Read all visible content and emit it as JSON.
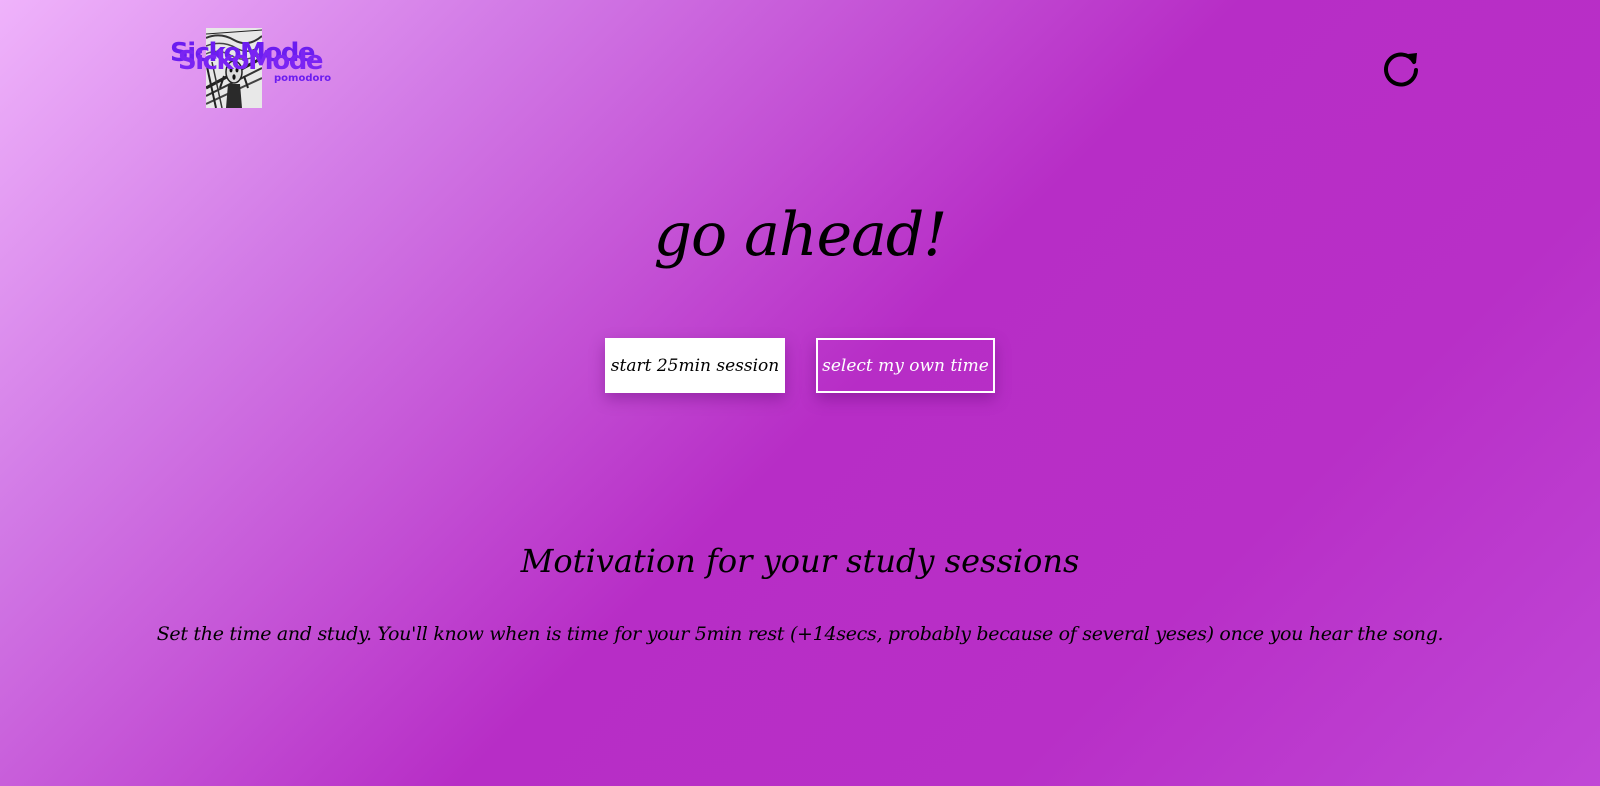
{
  "header": {
    "logo_title": "SickoMode",
    "logo_subtitle": "pomodoro",
    "reload_icon": "reload-icon"
  },
  "hero": {
    "title": "go ahead!",
    "start_button": "start 25min session",
    "select_button": "select my own time"
  },
  "motivation": {
    "title": "Motivation for your study sessions",
    "body": "Set the time and study. You'll know when is time for your 5min rest (+14secs, probably because of several yeses) once you hear the song."
  },
  "colors": {
    "background_start": "#efb3fb",
    "background_end": "#b72dc6",
    "logo_accent": "#6b1df0"
  }
}
